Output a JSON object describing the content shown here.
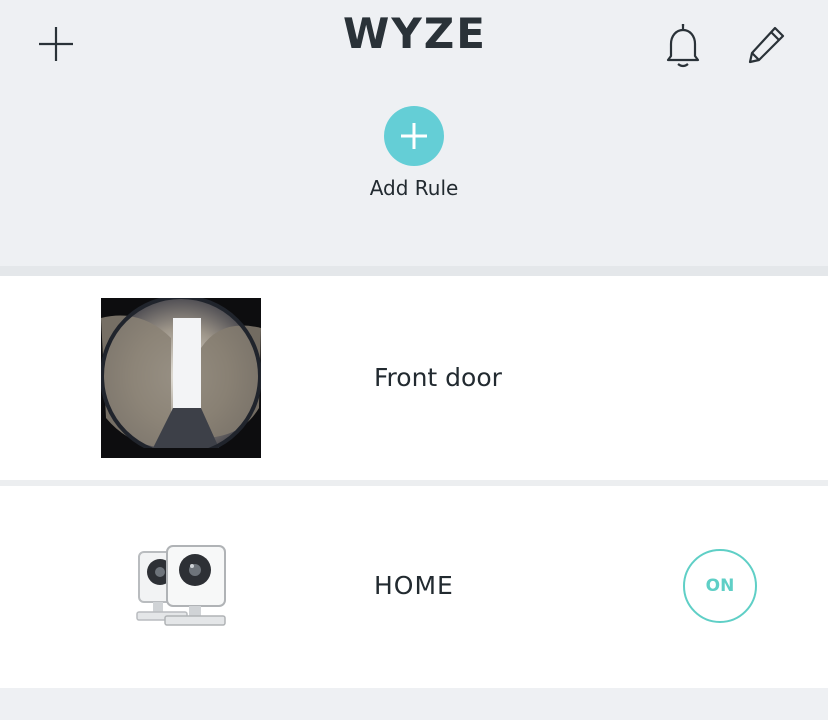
{
  "header": {
    "logo_text": "WYZE",
    "add_icon": "plus-icon",
    "notification_icon": "bell-icon",
    "edit_icon": "pencil-icon"
  },
  "add_rule": {
    "label": "Add Rule",
    "icon": "plus-circle-icon",
    "color": "#64ced6"
  },
  "devices": [
    {
      "name": "Front door",
      "thumbnail": "camera-snapshot"
    },
    {
      "name": "HOME",
      "thumbnail": "camera-group-icon",
      "toggle_label": "ON",
      "toggle_color": "#5fcfc6"
    }
  ]
}
